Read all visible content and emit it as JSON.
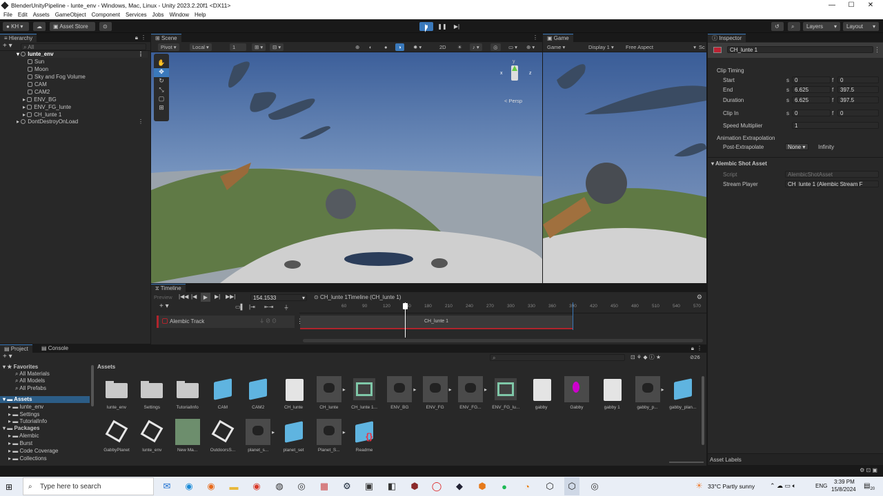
{
  "window": {
    "title": "BlenderUnityPipeline - lunte_env - Windows, Mac, Linux - Unity 2023.2.20f1 <DX11>",
    "min": "—",
    "max": "☐",
    "close": "✕"
  },
  "menu": [
    "File",
    "Edit",
    "Assets",
    "GameObject",
    "Component",
    "Services",
    "Jobs",
    "Window",
    "Help"
  ],
  "toolbar": {
    "account": "KH",
    "asset_store": "Asset Store",
    "layers": "Layers",
    "layout": "Layout"
  },
  "hierarchy": {
    "tab": "Hierarchy",
    "search_placeholder": "All",
    "items": [
      {
        "label": "lunte_env",
        "depth": 0
      },
      {
        "label": "Sun",
        "depth": 2
      },
      {
        "label": "Moon",
        "depth": 2
      },
      {
        "label": "Sky and Fog Volume",
        "depth": 2
      },
      {
        "label": "CAM",
        "depth": 2
      },
      {
        "label": "CAM2",
        "depth": 2
      },
      {
        "label": "ENV_BG",
        "depth": 1
      },
      {
        "label": "ENV_FG_lunte",
        "depth": 1
      },
      {
        "label": "CH_lunte 1",
        "depth": 1
      },
      {
        "label": "DontDestroyOnLoad",
        "depth": 0
      }
    ]
  },
  "scene": {
    "tab": "Scene",
    "pivot": "Pivot",
    "local": "Local",
    "grid_value": "1",
    "mode_2d": "2D",
    "persp": "< Persp",
    "gizmo_y": "y",
    "gizmo_x": "x",
    "gizmo_z": "z"
  },
  "game": {
    "tab": "Game",
    "game_dd": "Game",
    "display": "Display 1",
    "aspect": "Free Aspect",
    "scale": "Sc"
  },
  "inspector": {
    "tab": "Inspector",
    "object_name": "CH_lunte 1",
    "clip_timing": "Clip Timing",
    "rows": [
      {
        "label": "Start",
        "s_label": "s",
        "s": "0",
        "f_label": "f",
        "f": "0"
      },
      {
        "label": "End",
        "s_label": "s",
        "s": "6.625",
        "f_label": "f",
        "f": "397.5"
      },
      {
        "label": "Duration",
        "s_label": "s",
        "s": "6.625",
        "f_label": "f",
        "f": "397.5"
      },
      {
        "label": "Clip In",
        "s_label": "s",
        "s": "0",
        "f_label": "f",
        "f": "0"
      }
    ],
    "speed_label": "Speed Multiplier",
    "speed_value": "1",
    "anim_extrap": "Animation Extrapolation",
    "post_extrap_label": "Post-Extrapolate",
    "post_extrap_value": "None",
    "post_extrap_after": "Infinity",
    "alembic_header": "Alembic Shot Asset",
    "script_label": "Script",
    "script_value": "AlembicShotAsset",
    "stream_label": "Stream Player",
    "stream_value": "CH_lunte 1 (Alembic Stream F",
    "asset_labels": "Asset Labels"
  },
  "timeline": {
    "tab": "Timeline",
    "preview": "Preview",
    "frame": "154.1533",
    "sequence": "CH_lunte 1Timeline (CH_lunte 1)",
    "ruler": [
      "60",
      "90",
      "120",
      "150",
      "180",
      "210",
      "240",
      "270",
      "300",
      "330",
      "360",
      "390",
      "420",
      "450",
      "480",
      "510",
      "540",
      "570"
    ],
    "track": "Alembic Track",
    "clip": "CH_lunte 1"
  },
  "project": {
    "tab_project": "Project",
    "tab_console": "Console",
    "favorites": "Favorites",
    "fav_items": [
      "All Materials",
      "All Models",
      "All Prefabs"
    ],
    "assets_root": "Assets",
    "asset_folders": [
      "lunte_env",
      "Settings",
      "TutorialInfo"
    ],
    "packages": "Packages",
    "package_items": [
      "Alembic",
      "Burst",
      "Code Coverage",
      "Collections"
    ],
    "breadcrumb": "Assets",
    "count": "26",
    "grid": [
      {
        "label": "lunte_env",
        "kind": "folder"
      },
      {
        "label": "Settings",
        "kind": "folder"
      },
      {
        "label": "TutorialInfo",
        "kind": "folder"
      },
      {
        "label": "CAM",
        "kind": "prefab"
      },
      {
        "label": "CAM2",
        "kind": "prefab"
      },
      {
        "label": "CH_lunte",
        "kind": "file"
      },
      {
        "label": "CH_lunte",
        "kind": "model"
      },
      {
        "label": "CH_lunte 1...",
        "kind": "timeline"
      },
      {
        "label": "ENV_BG",
        "kind": "model"
      },
      {
        "label": "ENV_FG",
        "kind": "model"
      },
      {
        "label": "ENV_FG...",
        "kind": "model"
      },
      {
        "label": "ENV_FG_lu...",
        "kind": "timeline"
      },
      {
        "label": "gabby",
        "kind": "file"
      },
      {
        "label": "Gabby",
        "kind": "magenta"
      },
      {
        "label": "gabby 1",
        "kind": "file"
      },
      {
        "label": "gabby_p...",
        "kind": "model"
      },
      {
        "label": "gabby_plan...",
        "kind": "prefab"
      },
      {
        "label": "GabbyPlanet",
        "kind": "unity"
      },
      {
        "label": "lunte_env",
        "kind": "unity"
      },
      {
        "label": "New Ma...",
        "kind": "material"
      },
      {
        "label": "OutdoorsS...",
        "kind": "unity"
      },
      {
        "label": "planet_s...",
        "kind": "model"
      },
      {
        "label": "planet_set",
        "kind": "prefab"
      },
      {
        "label": "Planet_S...",
        "kind": "model"
      },
      {
        "label": "Readme",
        "kind": "readme"
      }
    ]
  },
  "taskbar": {
    "search_placeholder": "Type here to search",
    "weather": "33°C  Partly sunny",
    "lang": "ENG",
    "time": "3:39 PM",
    "date": "15/8/2024",
    "notif": "20"
  },
  "colors": {
    "accent": "#3a79bb",
    "track_red": "#b0242c",
    "panel": "#282828",
    "dark": "#191919"
  }
}
